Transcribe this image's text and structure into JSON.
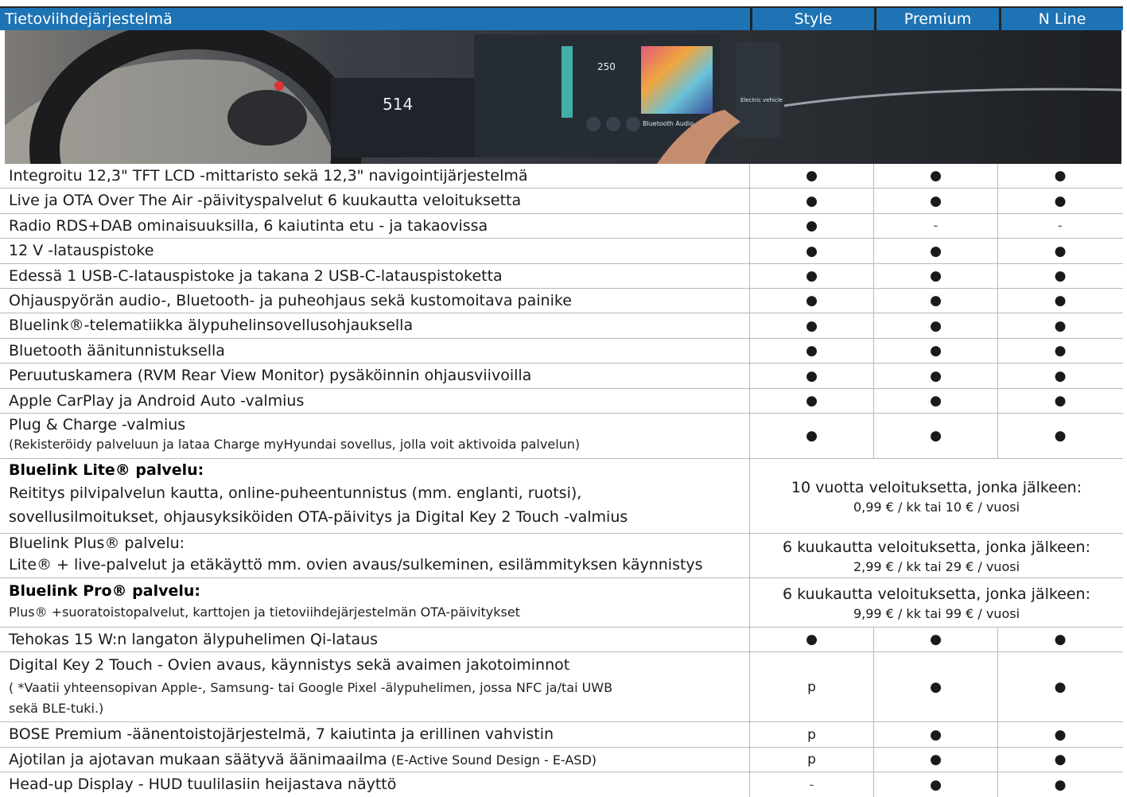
{
  "header": {
    "title": "Tietoviihdejärjestelmä",
    "col1": "Style",
    "col2": "Premium",
    "col3": "N Line"
  },
  "rows": [
    {
      "feature": "Integroitu 12,3\" TFT LCD -mittaristo sekä 12,3\" navigointijärjestelmä",
      "style": "●",
      "premium": "●",
      "nline": "●"
    },
    {
      "feature": "Live ja OTA Over The Air -päivityspalvelut 6 kuukautta veloituksetta",
      "style": "●",
      "premium": "●",
      "nline": "●"
    },
    {
      "feature": "Radio RDS+DAB ominaisuuksilla, 6 kaiutinta etu - ja takaovissa",
      "style": "●",
      "premium": "-",
      "nline": "-"
    },
    {
      "feature": "12 V -latauspistoke",
      "style": "●",
      "premium": "●",
      "nline": "●"
    },
    {
      "feature": "Edessä 1 USB-C-latauspistoke ja takana 2 USB-C-latauspistoketta",
      "style": "●",
      "premium": "●",
      "nline": "●"
    },
    {
      "feature": "Ohjauspyörän audio-, Bluetooth- ja puheohjaus sekä kustomoitava painike",
      "style": "●",
      "premium": "●",
      "nline": "●"
    },
    {
      "feature": "Bluelink®-telematiikka älypuhelinsovellusohjauksella",
      "style": "●",
      "premium": "●",
      "nline": "●"
    },
    {
      "feature": "Bluetooth äänitunnistuksella",
      "style": "●",
      "premium": "●",
      "nline": "●"
    },
    {
      "feature": "Peruutuskamera (RVM Rear View Monitor)  pysäköinnin ohjausviivoilla",
      "style": "●",
      "premium": "●",
      "nline": "●"
    },
    {
      "feature": "Apple CarPlay ja Android Auto -valmius",
      "style": "●",
      "premium": "●",
      "nline": "●"
    },
    {
      "feature": "Plug & Charge -valmius",
      "note": "(Rekisteröidy palveluun ja lataa Charge myHyundai sovellus, jolla voit aktivoida palvelun)",
      "style": "●",
      "premium": "●",
      "nline": "●"
    },
    {
      "feature": "Bluelink Lite® palvelu:",
      "note": "Reititys pilvipalvelun kautta, online-puheentunnistus (mm. englanti, ruotsi),",
      "note2": "sovellusilmoitukset, ohjausyksiköiden OTA-päivitys ja Digital Key 2 Touch -valmius",
      "merged1": "10 vuotta veloituksetta, jonka jälkeen:",
      "merged2": "0,99 € / kk tai 10 € / vuosi"
    },
    {
      "feature": "Bluelink Plus® palvelu:",
      "note": "Lite® + live-palvelut ja etäkäyttö mm. ovien avaus/sulkeminen, esilämmityksen käynnistys",
      "merged1": "6 kuukautta veloituksetta, jonka jälkeen:",
      "merged2": "2,99 € / kk tai 29 € / vuosi"
    },
    {
      "feature": "Bluelink Pro® palvelu:",
      "note": "Plus® +suoratoistopalvelut, karttojen ja tietoviihdejärjestelmän OTA-päivitykset",
      "merged1": "6 kuukautta veloituksetta, jonka jälkeen:",
      "merged2": "9,99 € / kk tai 99 € / vuosi"
    },
    {
      "feature": "Tehokas 15 W:n langaton älypuhelimen Qi-lataus",
      "style": "●",
      "premium": "●",
      "nline": "●"
    },
    {
      "feature": "Digital Key 2 Touch - Ovien avaus, käynnistys sekä avaimen jakotoiminnot",
      "note": "( *Vaatii yhteensopivan Apple-, Samsung- tai Google Pixel -älypuhelimen, jossa NFC ja/tai UWB",
      "note2": "sekä BLE-tuki.)",
      "style": "p",
      "premium": "●",
      "nline": "●"
    },
    {
      "feature": "BOSE Premium -äänentoistojärjestelmä, 7 kaiutinta ja erillinen vahvistin",
      "style": "p",
      "premium": "●",
      "nline": "●"
    },
    {
      "feature": "Ajotilan ja ajotavan mukaan säätyvä äänimaailma",
      "feature_small": " (E-Active Sound Design - E-ASD)",
      "style": "p",
      "premium": "●",
      "nline": "●"
    },
    {
      "feature": "Head-up Display - HUD tuulilasiin heijastava näyttö",
      "style": "-",
      "premium": "●",
      "nline": "●"
    }
  ],
  "photo": {
    "cluster_value": "514",
    "screen_label": "Bluetooth Audio",
    "range_value": "250",
    "right_panel_label": "Electric vehicle"
  }
}
